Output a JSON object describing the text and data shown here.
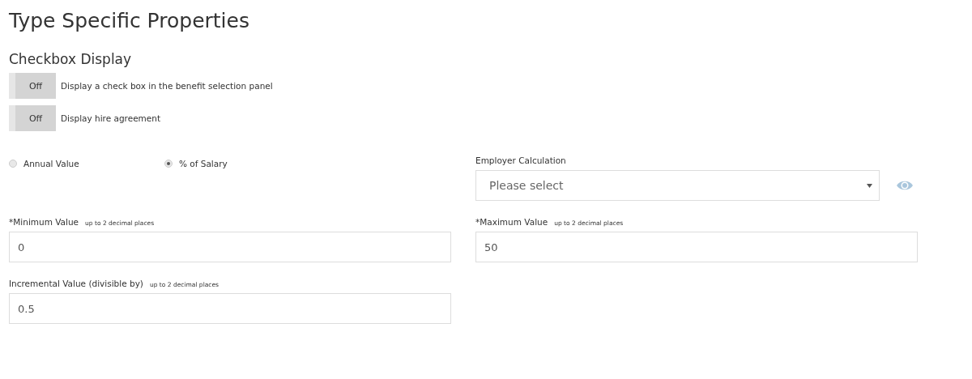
{
  "title": "Type Specific Properties",
  "checkbox_display": {
    "heading": "Checkbox Display",
    "toggles": [
      {
        "state_label": "Off",
        "on": false,
        "label": "Display a check box in the benefit selection panel"
      },
      {
        "state_label": "Off",
        "on": false,
        "label": "Display hire agreement"
      }
    ]
  },
  "value_type": [
    {
      "label": "Annual Value",
      "selected": false
    },
    {
      "label": "% of Salary",
      "selected": true
    }
  ],
  "employer_calculation": {
    "label": "Employer Calculation",
    "placeholder": "Please select"
  },
  "fields": [
    {
      "label": "*Minimum Value",
      "hint": "up to 2 decimal places",
      "value": "0"
    },
    {
      "label": "*Maximum Value",
      "hint": "up to 2 decimal places",
      "value": "50"
    },
    {
      "label": "Incremental Value (divisible by)",
      "hint": "up to 2 decimal places",
      "value": "0.5"
    }
  ]
}
